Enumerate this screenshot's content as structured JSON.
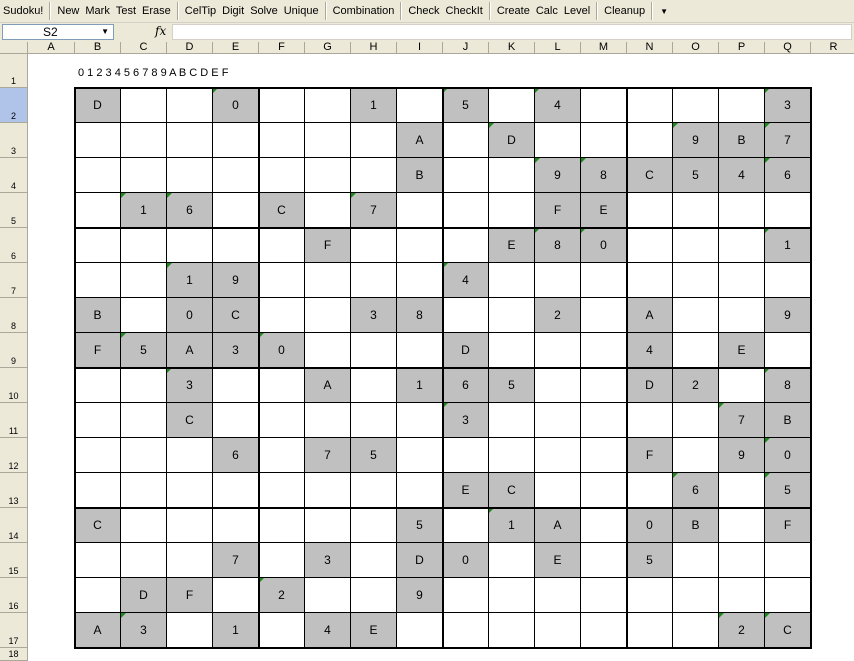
{
  "menubar": {
    "items": [
      "Sudoku!",
      "New",
      "Mark",
      "Test",
      "Erase",
      "CelTip",
      "Digit",
      "Solve",
      "Unique",
      "Combination",
      "Check",
      "CheckIt",
      "Create",
      "Calc",
      "Level",
      "Cleanup"
    ],
    "groups": [
      [
        0
      ],
      [
        1,
        2,
        3,
        4
      ],
      [
        5,
        6,
        7,
        8
      ],
      [
        9
      ],
      [
        10,
        11
      ],
      [
        12,
        13,
        14
      ],
      [
        15
      ]
    ],
    "overflow_icon": "dropdown-arrow-icon"
  },
  "formula": {
    "namebox": "S2",
    "fx_label": "fx",
    "value": ""
  },
  "columns": [
    "A",
    "B",
    "C",
    "D",
    "E",
    "F",
    "G",
    "H",
    "I",
    "J",
    "K",
    "L",
    "M",
    "N",
    "O",
    "P",
    "Q",
    "R"
  ],
  "rows": [
    "1",
    "2",
    "3",
    "4",
    "5",
    "6",
    "7",
    "8",
    "9",
    "10",
    "11",
    "12",
    "13",
    "14",
    "15",
    "16",
    "17",
    "18"
  ],
  "active_col": "S",
  "active_row": "2",
  "symbols_label": "0 1 2 3 4 5 6 7 8 9 A B C D E F",
  "colors": {
    "filled": "#c0c0c0",
    "given_marker": "#1a8a1a",
    "header": "#ece9d8"
  },
  "board": [
    [
      "D",
      "",
      "",
      "0",
      "",
      "",
      "1",
      "",
      "5",
      "",
      "4",
      "",
      "",
      "",
      "",
      "3"
    ],
    [
      "",
      "",
      "",
      "",
      "",
      "",
      "",
      "A",
      "",
      "D",
      "",
      "",
      "",
      "9",
      "B",
      "7"
    ],
    [
      "",
      "",
      "",
      "",
      "",
      "",
      "",
      "B",
      "",
      "",
      "9",
      "8",
      "C",
      "5",
      "4",
      "6"
    ],
    [
      "",
      "1",
      "6",
      "",
      "C",
      "",
      "7",
      "",
      "",
      "",
      "F",
      "E",
      "",
      "",
      "",
      ""
    ],
    [
      "",
      "",
      "",
      "",
      "",
      "F",
      "",
      "",
      "",
      "E",
      "8",
      "0",
      "",
      "",
      "",
      "1"
    ],
    [
      "",
      "",
      "1",
      "9",
      "",
      "",
      "",
      "",
      "4",
      "",
      "",
      "",
      "",
      "",
      "",
      ""
    ],
    [
      "B",
      "",
      "0",
      "C",
      "",
      "",
      "3",
      "8",
      "",
      "",
      "2",
      "",
      "A",
      "",
      "",
      "9"
    ],
    [
      "F",
      "5",
      "A",
      "3",
      "0",
      "",
      "",
      "",
      "D",
      "",
      "",
      "",
      "4",
      "",
      "E",
      ""
    ],
    [
      "",
      "",
      "3",
      "",
      "",
      "A",
      "",
      "1",
      "6",
      "5",
      "",
      "",
      "D",
      "2",
      "",
      "8"
    ],
    [
      "",
      "",
      "C",
      "",
      "",
      "",
      "",
      "",
      "3",
      "",
      "",
      "",
      "",
      "",
      "7",
      "B"
    ],
    [
      "",
      "",
      "",
      "6",
      "",
      "7",
      "5",
      "",
      "",
      "",
      "",
      "",
      "F",
      "",
      "9",
      "0"
    ],
    [
      "",
      "",
      "",
      "",
      "",
      "",
      "",
      "",
      "E",
      "C",
      "",
      "",
      "",
      "6",
      "",
      "5"
    ],
    [
      "C",
      "",
      "",
      "",
      "",
      "",
      "",
      "5",
      "",
      "1",
      "A",
      "",
      "0",
      "B",
      "",
      "F"
    ],
    [
      "",
      "",
      "",
      "7",
      "",
      "3",
      "",
      "D",
      "0",
      "",
      "E",
      "",
      "5",
      "",
      "",
      ""
    ],
    [
      "",
      "D",
      "F",
      "",
      "2",
      "",
      "",
      "9",
      "",
      "",
      "",
      "",
      "",
      "",
      "",
      ""
    ],
    [
      "A",
      "3",
      "",
      "1",
      "",
      "4",
      "E",
      "",
      "",
      "",
      "",
      "",
      "",
      "",
      "2",
      "C"
    ]
  ],
  "filled": [
    [
      1,
      0,
      0,
      1,
      0,
      0,
      1,
      0,
      1,
      0,
      1,
      0,
      0,
      0,
      0,
      1
    ],
    [
      0,
      0,
      0,
      0,
      0,
      0,
      0,
      1,
      0,
      1,
      0,
      0,
      0,
      1,
      1,
      1
    ],
    [
      0,
      0,
      0,
      0,
      0,
      0,
      0,
      1,
      0,
      0,
      1,
      1,
      1,
      1,
      1,
      1
    ],
    [
      0,
      1,
      1,
      0,
      1,
      0,
      1,
      0,
      0,
      0,
      1,
      1,
      0,
      0,
      0,
      0
    ],
    [
      0,
      0,
      0,
      0,
      0,
      1,
      0,
      0,
      0,
      1,
      1,
      1,
      0,
      0,
      0,
      1
    ],
    [
      0,
      0,
      1,
      1,
      0,
      0,
      0,
      0,
      1,
      0,
      0,
      0,
      0,
      0,
      0,
      0
    ],
    [
      1,
      0,
      1,
      1,
      0,
      0,
      1,
      1,
      0,
      0,
      1,
      0,
      1,
      0,
      0,
      1
    ],
    [
      1,
      1,
      1,
      1,
      1,
      0,
      0,
      0,
      1,
      0,
      0,
      0,
      1,
      0,
      1,
      0
    ],
    [
      0,
      0,
      1,
      0,
      0,
      1,
      0,
      1,
      1,
      1,
      0,
      0,
      1,
      1,
      0,
      1
    ],
    [
      0,
      0,
      1,
      0,
      0,
      0,
      0,
      0,
      1,
      0,
      0,
      0,
      0,
      0,
      1,
      1
    ],
    [
      0,
      0,
      0,
      1,
      0,
      1,
      1,
      0,
      0,
      0,
      0,
      0,
      1,
      0,
      1,
      1
    ],
    [
      0,
      0,
      0,
      0,
      0,
      0,
      0,
      0,
      1,
      1,
      0,
      0,
      0,
      1,
      0,
      1
    ],
    [
      1,
      0,
      0,
      0,
      0,
      0,
      0,
      1,
      0,
      1,
      1,
      0,
      1,
      1,
      0,
      1
    ],
    [
      0,
      0,
      0,
      1,
      0,
      1,
      0,
      1,
      1,
      0,
      1,
      0,
      1,
      0,
      0,
      0
    ],
    [
      0,
      1,
      1,
      0,
      1,
      0,
      0,
      1,
      0,
      0,
      0,
      0,
      0,
      0,
      0,
      0
    ],
    [
      1,
      1,
      0,
      1,
      0,
      1,
      1,
      0,
      0,
      0,
      0,
      0,
      0,
      0,
      1,
      1
    ]
  ],
  "given": [
    [
      0,
      0,
      0,
      1,
      0,
      0,
      0,
      0,
      1,
      0,
      1,
      0,
      0,
      0,
      0,
      1
    ],
    [
      0,
      0,
      0,
      0,
      0,
      0,
      0,
      0,
      0,
      1,
      0,
      0,
      0,
      1,
      0,
      1
    ],
    [
      0,
      0,
      0,
      0,
      0,
      0,
      0,
      0,
      0,
      0,
      1,
      1,
      0,
      0,
      0,
      1
    ],
    [
      0,
      1,
      1,
      0,
      0,
      0,
      1,
      0,
      0,
      0,
      0,
      0,
      0,
      0,
      0,
      0
    ],
    [
      0,
      0,
      0,
      0,
      0,
      0,
      0,
      0,
      0,
      0,
      1,
      1,
      0,
      0,
      0,
      1
    ],
    [
      0,
      0,
      1,
      0,
      0,
      0,
      0,
      0,
      1,
      0,
      0,
      0,
      0,
      0,
      0,
      0
    ],
    [
      0,
      0,
      0,
      0,
      0,
      0,
      0,
      0,
      0,
      0,
      0,
      0,
      0,
      0,
      0,
      0
    ],
    [
      0,
      1,
      0,
      0,
      1,
      0,
      0,
      0,
      0,
      0,
      0,
      0,
      0,
      0,
      0,
      0
    ],
    [
      0,
      0,
      1,
      0,
      0,
      0,
      0,
      0,
      0,
      0,
      0,
      0,
      0,
      0,
      0,
      1
    ],
    [
      0,
      0,
      0,
      0,
      0,
      0,
      0,
      0,
      1,
      0,
      0,
      0,
      0,
      0,
      1,
      0
    ],
    [
      0,
      0,
      0,
      0,
      0,
      0,
      0,
      0,
      0,
      0,
      0,
      0,
      0,
      0,
      0,
      1
    ],
    [
      0,
      0,
      0,
      0,
      0,
      0,
      0,
      0,
      0,
      0,
      0,
      0,
      0,
      1,
      0,
      1
    ],
    [
      0,
      0,
      0,
      0,
      0,
      0,
      0,
      0,
      0,
      1,
      0,
      0,
      0,
      0,
      0,
      0
    ],
    [
      0,
      0,
      0,
      0,
      0,
      0,
      0,
      0,
      0,
      0,
      0,
      0,
      0,
      0,
      0,
      0
    ],
    [
      0,
      0,
      0,
      0,
      1,
      0,
      0,
      0,
      0,
      0,
      0,
      0,
      0,
      0,
      0,
      0
    ],
    [
      0,
      1,
      0,
      0,
      0,
      0,
      0,
      0,
      0,
      0,
      0,
      0,
      0,
      0,
      1,
      1
    ]
  ]
}
